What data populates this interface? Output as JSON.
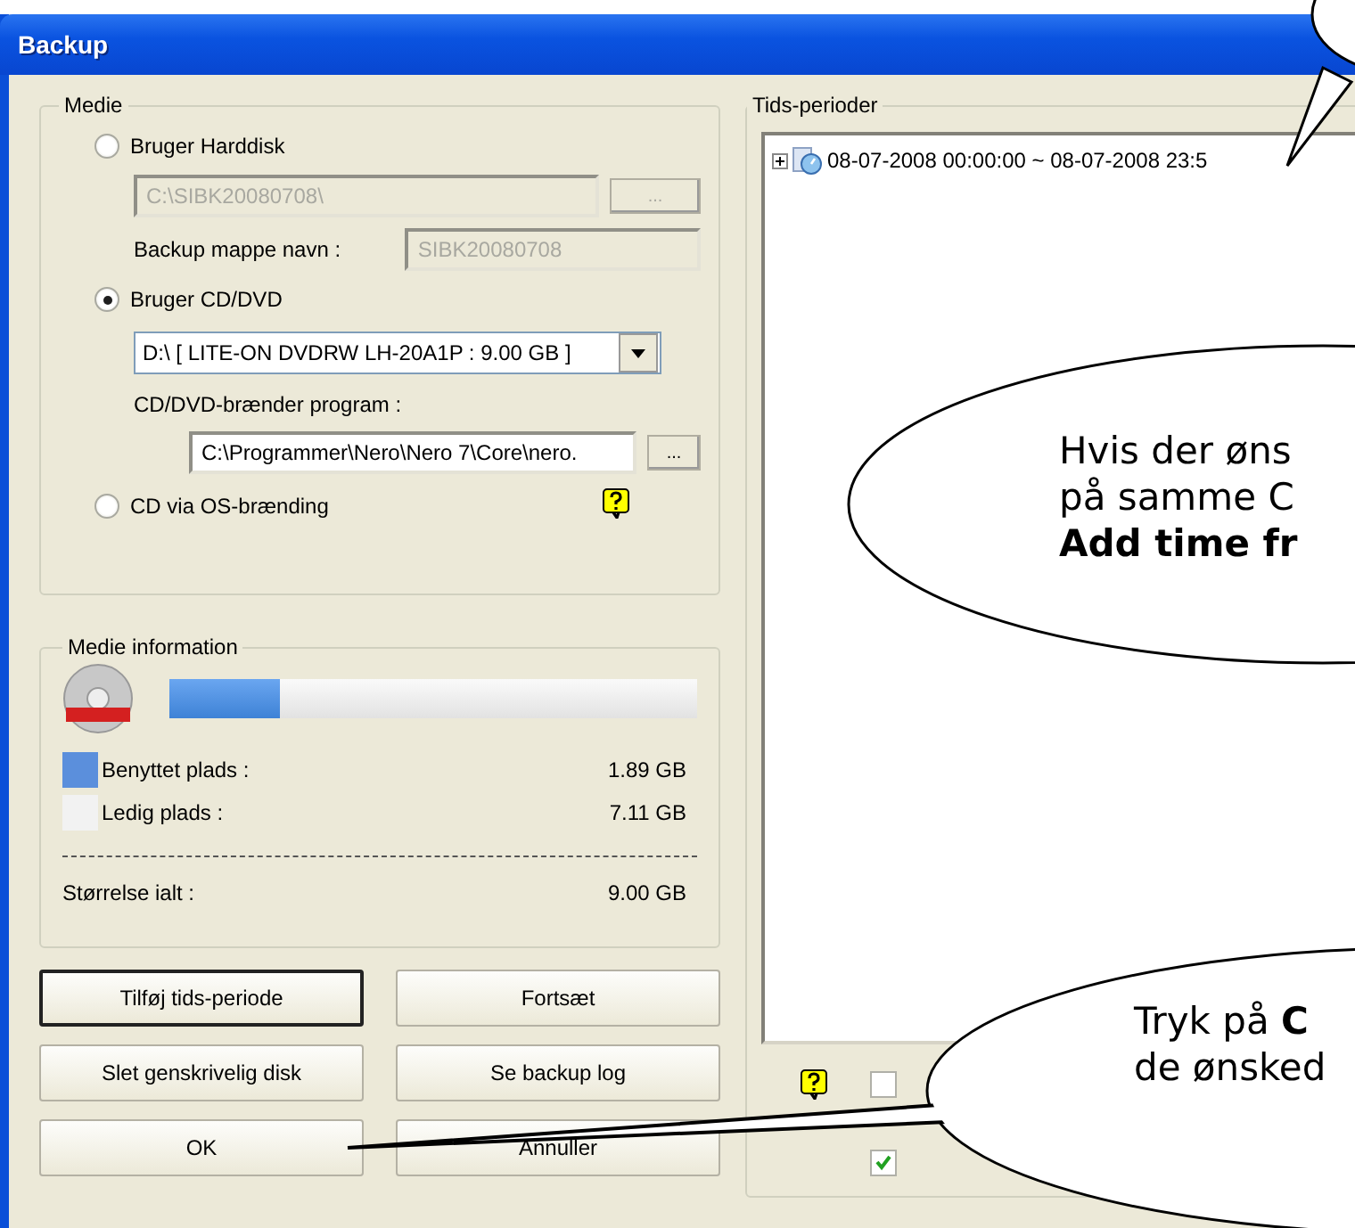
{
  "window": {
    "title": "Backup"
  },
  "media": {
    "title": "Medie",
    "options": [
      {
        "kind": "harddisk",
        "label": "Bruger Harddisk",
        "selected": false,
        "path": "C:\\SIBK20080708\\",
        "browse": "...",
        "folder_label": "Backup mappe navn :",
        "folder_value": "SIBK20080708"
      },
      {
        "kind": "cd",
        "label": "Bruger CD/DVD",
        "selected": true,
        "drive": "D:\\ [ LITE-ON  DVDRW LH-20A1P   : 9.00 GB ]",
        "burner_label": "CD/DVD-brænder program :",
        "burner_path": "C:\\Programmer\\Nero\\Nero 7\\Core\\nero.",
        "browse": "..."
      },
      {
        "kind": "os",
        "label": "CD via OS-brænding",
        "selected": false
      }
    ]
  },
  "media_info": {
    "title": "Medie information",
    "level": 0.21,
    "rows": [
      {
        "label": "Benyttet plads :",
        "value": "1.89 GB",
        "color": "#5b8fdc"
      },
      {
        "label": "Ledig plads :",
        "value": "7.11 GB",
        "color": "#f2f2f2"
      }
    ],
    "total": {
      "label": "Størrelse ialt :",
      "value": "9.00 GB"
    }
  },
  "buttons": [
    {
      "label": "Tilføj tids-periode",
      "focused": true
    },
    {
      "label": "Fortsæt",
      "focused": false
    },
    {
      "label": "Slet genskrivelig disk",
      "focused": false
    },
    {
      "label": "Se backup log",
      "focused": false
    },
    {
      "label": "OK",
      "focused": false
    },
    {
      "label": "Annuller",
      "focused": false
    }
  ],
  "periods": {
    "title": "Tids-perioder",
    "items": [
      {
        "label": "08-07-2008 00:00:00 ~ 08-07-2008 23:5",
        "expanded": false
      }
    ],
    "checkboxes": [
      {
        "checked": false
      },
      {
        "checked": true
      }
    ]
  },
  "callouts": [
    {
      "kind": "small"
    },
    {
      "kind": "text",
      "lines": [
        "Hvis der øns",
        "på samme C",
        "**Add time fr**"
      ]
    },
    {
      "kind": "text",
      "lines": [
        "Tryk på **C**",
        "de ønsked"
      ]
    }
  ]
}
